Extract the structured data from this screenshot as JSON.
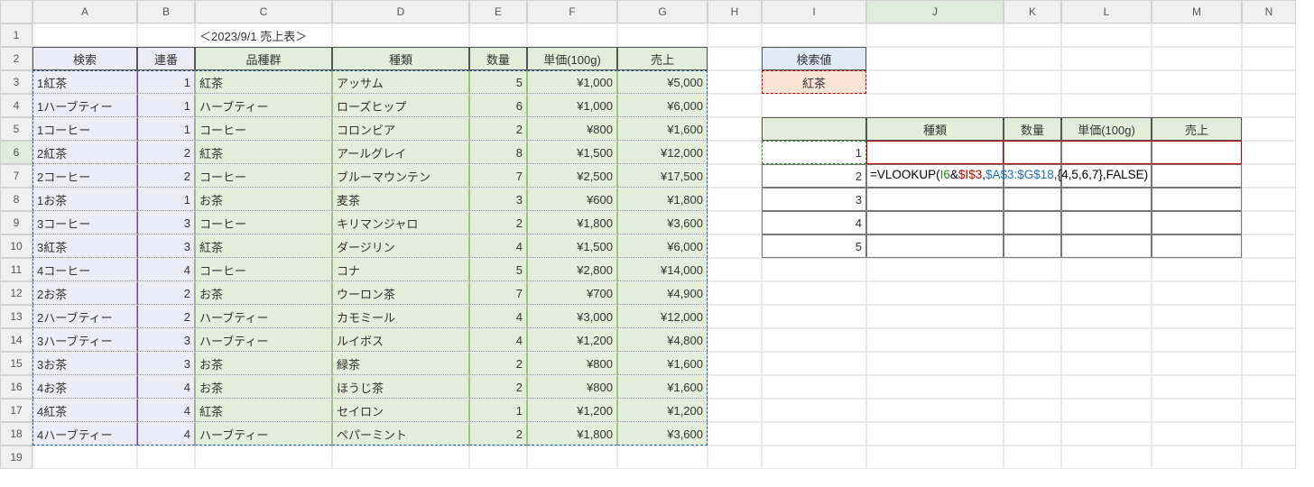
{
  "columns": [
    "A",
    "B",
    "C",
    "D",
    "E",
    "F",
    "G",
    "H",
    "I",
    "J",
    "K",
    "L",
    "M",
    "N"
  ],
  "title": "＜2023/9/1 売上表＞",
  "main_headers": {
    "A": "検索",
    "B": "連番",
    "C": "品種群",
    "D": "種類",
    "E": "数量",
    "F": "単価(100g)",
    "G": "売上"
  },
  "rows": [
    {
      "a": "1紅茶",
      "b": "1",
      "c": "紅茶",
      "d": "アッサム",
      "e": "5",
      "f": "¥1,000",
      "g": "¥5,000"
    },
    {
      "a": "1ハーブティー",
      "b": "1",
      "c": "ハーブティー",
      "d": "ローズヒップ",
      "e": "6",
      "f": "¥1,000",
      "g": "¥6,000"
    },
    {
      "a": "1コーヒー",
      "b": "1",
      "c": "コーヒー",
      "d": "コロンビア",
      "e": "2",
      "f": "¥800",
      "g": "¥1,600"
    },
    {
      "a": "2紅茶",
      "b": "2",
      "c": "紅茶",
      "d": "アールグレイ",
      "e": "8",
      "f": "¥1,500",
      "g": "¥12,000"
    },
    {
      "a": "2コーヒー",
      "b": "2",
      "c": "コーヒー",
      "d": "ブルーマウンテン",
      "e": "7",
      "f": "¥2,500",
      "g": "¥17,500"
    },
    {
      "a": "1お茶",
      "b": "1",
      "c": "お茶",
      "d": "麦茶",
      "e": "3",
      "f": "¥600",
      "g": "¥1,800"
    },
    {
      "a": "3コーヒー",
      "b": "3",
      "c": "コーヒー",
      "d": "キリマンジャロ",
      "e": "2",
      "f": "¥1,800",
      "g": "¥3,600"
    },
    {
      "a": "3紅茶",
      "b": "3",
      "c": "紅茶",
      "d": "ダージリン",
      "e": "4",
      "f": "¥1,500",
      "g": "¥6,000"
    },
    {
      "a": "4コーヒー",
      "b": "4",
      "c": "コーヒー",
      "d": "コナ",
      "e": "5",
      "f": "¥2,800",
      "g": "¥14,000"
    },
    {
      "a": "2お茶",
      "b": "2",
      "c": "お茶",
      "d": "ウーロン茶",
      "e": "7",
      "f": "¥700",
      "g": "¥4,900"
    },
    {
      "a": "2ハーブティー",
      "b": "2",
      "c": "ハーブティー",
      "d": "カモミール",
      "e": "4",
      "f": "¥3,000",
      "g": "¥12,000"
    },
    {
      "a": "3ハーブティー",
      "b": "3",
      "c": "ハーブティー",
      "d": "ルイボス",
      "e": "4",
      "f": "¥1,200",
      "g": "¥4,800"
    },
    {
      "a": "3お茶",
      "b": "3",
      "c": "お茶",
      "d": "緑茶",
      "e": "2",
      "f": "¥800",
      "g": "¥1,600"
    },
    {
      "a": "4お茶",
      "b": "4",
      "c": "お茶",
      "d": "ほうじ茶",
      "e": "2",
      "f": "¥800",
      "g": "¥1,600"
    },
    {
      "a": "4紅茶",
      "b": "4",
      "c": "紅茶",
      "d": "セイロン",
      "e": "1",
      "f": "¥1,200",
      "g": "¥1,200"
    },
    {
      "a": "4ハーブティー",
      "b": "4",
      "c": "ハーブティー",
      "d": "ペパーミント",
      "e": "2",
      "f": "¥1,800",
      "g": "¥3,600"
    }
  ],
  "search_label": "検索値",
  "search_value": "紅茶",
  "lookup_headers": {
    "J": "種類",
    "K": "数量",
    "L": "単価(100g)",
    "M": "売上"
  },
  "lookup_index": [
    "1",
    "2",
    "3",
    "4",
    "5"
  ],
  "formula": {
    "prefix": "=VLOOKUP(",
    "arg1": "I6",
    "amp": "&",
    "arg2": "$I$3",
    "c1": ",",
    "arg3": "$A$3:$G$18",
    "c2": ",",
    "arg4": "{4,5,6,7}",
    "c3": ",FALSE)"
  },
  "active_cell": "J6",
  "chart_data": {
    "type": "table",
    "title": "2023/9/1 売上表",
    "columns": [
      "検索",
      "連番",
      "品種群",
      "種類",
      "数量",
      "単価(100g)",
      "売上"
    ],
    "data": [
      [
        "1紅茶",
        1,
        "紅茶",
        "アッサム",
        5,
        1000,
        5000
      ],
      [
        "1ハーブティー",
        1,
        "ハーブティー",
        "ローズヒップ",
        6,
        1000,
        6000
      ],
      [
        "1コーヒー",
        1,
        "コーヒー",
        "コロンビア",
        2,
        800,
        1600
      ],
      [
        "2紅茶",
        2,
        "紅茶",
        "アールグレイ",
        8,
        1500,
        12000
      ],
      [
        "2コーヒー",
        2,
        "コーヒー",
        "ブルーマウンテン",
        7,
        2500,
        17500
      ],
      [
        "1お茶",
        1,
        "お茶",
        "麦茶",
        3,
        600,
        1800
      ],
      [
        "3コーヒー",
        3,
        "コーヒー",
        "キリマンジャロ",
        2,
        1800,
        3600
      ],
      [
        "3紅茶",
        3,
        "紅茶",
        "ダージリン",
        4,
        1500,
        6000
      ],
      [
        "4コーヒー",
        4,
        "コーヒー",
        "コナ",
        5,
        2800,
        14000
      ],
      [
        "2お茶",
        2,
        "お茶",
        "ウーロン茶",
        7,
        700,
        4900
      ],
      [
        "2ハーブティー",
        2,
        "ハーブティー",
        "カモミール",
        4,
        3000,
        12000
      ],
      [
        "3ハーブティー",
        3,
        "ハーブティー",
        "ルイボス",
        4,
        1200,
        4800
      ],
      [
        "3お茶",
        3,
        "お茶",
        "緑茶",
        2,
        800,
        1600
      ],
      [
        "4お茶",
        4,
        "お茶",
        "ほうじ茶",
        2,
        800,
        1600
      ],
      [
        "4紅茶",
        4,
        "紅茶",
        "セイロン",
        1,
        1200,
        1200
      ],
      [
        "4ハーブティー",
        4,
        "ハーブティー",
        "ペパーミント",
        2,
        1800,
        3600
      ]
    ]
  }
}
